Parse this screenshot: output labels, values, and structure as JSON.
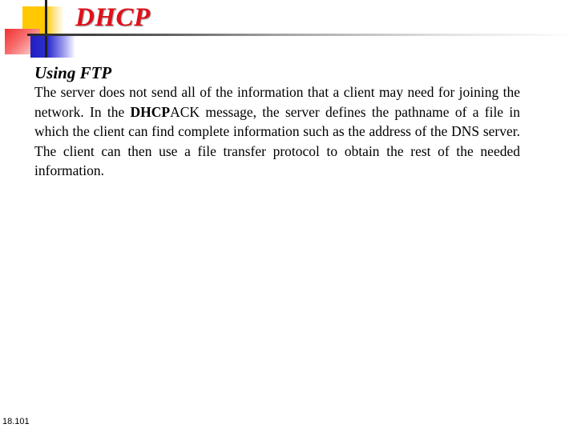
{
  "slide": {
    "title": "DHCP",
    "subtitle": "Using FTP",
    "paragraph": {
      "part1": "The server does not send all of the information that a client may need for joining the network. In the ",
      "bold": "DHCP",
      "part2": "ACK message, the server defines the pathname of a file in which the client can find complete information such as the address of the DNS server. The client can then use a file transfer protocol to obtain the rest of the needed information."
    },
    "slide_number": "18.101"
  },
  "colors": {
    "title": "#e0101a",
    "accent_yellow": "#ffc800",
    "accent_red": "#f03030",
    "accent_blue": "#2020c0"
  }
}
